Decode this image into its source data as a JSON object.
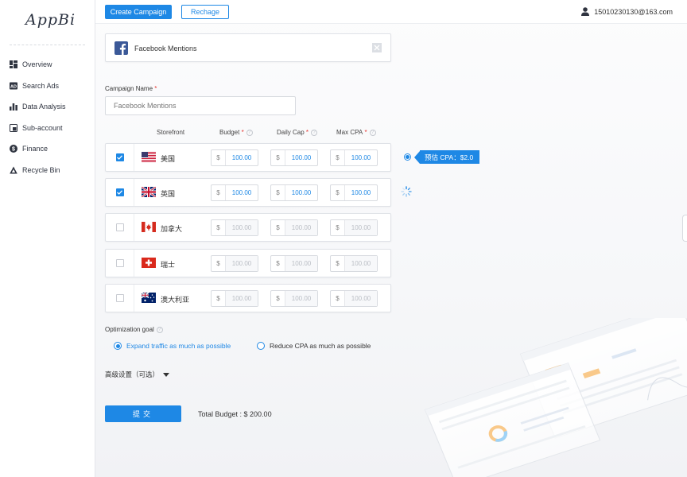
{
  "sidebar": {
    "logo": "AppBi",
    "items": [
      {
        "label": "Overview",
        "icon": "dashboard-icon"
      },
      {
        "label": "Search Ads",
        "icon": "ad-icon"
      },
      {
        "label": "Data Analysis",
        "icon": "bar-chart-icon"
      },
      {
        "label": "Sub-account",
        "icon": "sub-account-icon"
      },
      {
        "label": "Finance",
        "icon": "dollar-icon"
      },
      {
        "label": "Recycle Bin",
        "icon": "recycle-icon"
      }
    ]
  },
  "topbar": {
    "create_label": "Create Campaign",
    "recharge_label": "Rechage",
    "user_email": "15010230130@163.com"
  },
  "app_card": {
    "name": "Facebook Mentions"
  },
  "form": {
    "campaign_name_label": "Campaign Name",
    "campaign_name_value": "Facebook Mentions",
    "required_mark": "*",
    "currency_symbol": "$"
  },
  "columns": {
    "storefront": "Storefront",
    "budget": "Budget",
    "daily_cap": "Daily Cap",
    "max_cpa": "Max CPA"
  },
  "rows": [
    {
      "country": "美国",
      "flag": "us",
      "checked": true,
      "budget": "100.00",
      "daily_cap": "100.00",
      "max_cpa": "100.00"
    },
    {
      "country": "英国",
      "flag": "uk",
      "checked": true,
      "budget": "100.00",
      "daily_cap": "100.00",
      "max_cpa": "100.00"
    },
    {
      "country": "加拿大",
      "flag": "ca",
      "checked": false,
      "budget": "100.00",
      "daily_cap": "100.00",
      "max_cpa": "100.00"
    },
    {
      "country": "瑞士",
      "flag": "ch",
      "checked": false,
      "budget": "100.00",
      "daily_cap": "100.00",
      "max_cpa": "100.00"
    },
    {
      "country": "澳大利亚",
      "flag": "au",
      "checked": false,
      "budget": "100.00",
      "daily_cap": "100.00",
      "max_cpa": "100.00"
    }
  ],
  "cpa_tooltip": "预估 CPA：$2.0",
  "optimization": {
    "label": "Optimization goal",
    "options": [
      {
        "label": "Expand traffic as much as possible",
        "selected": true
      },
      {
        "label": "Reduce CPA as much as possible",
        "selected": false
      }
    ]
  },
  "advanced_label": "高级设置（可选）",
  "submit_label": "提交",
  "total_budget": "Total Budget : $ 200.00",
  "colors": {
    "primary": "#1e88e5",
    "required": "#e53935"
  }
}
